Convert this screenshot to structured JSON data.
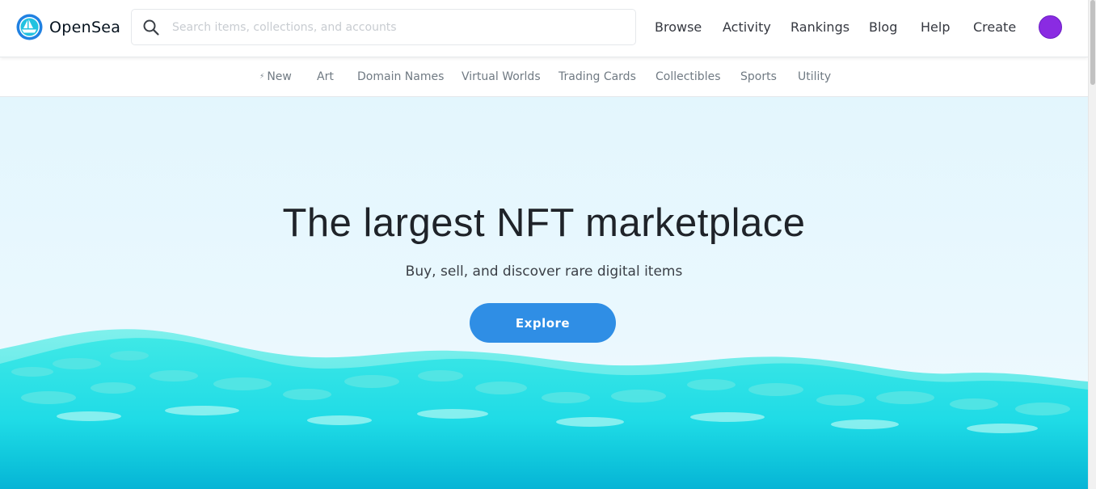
{
  "header": {
    "brand": "OpenSea",
    "logo_icon": "opensea-boat-logo",
    "search": {
      "placeholder": "Search items, collections, and accounts",
      "value": "",
      "icon": "search-icon"
    },
    "nav": [
      "Browse",
      "Activity",
      "Rankings",
      "Blog",
      "Help",
      "Create"
    ],
    "avatar_color": "#8a2be2"
  },
  "categories": {
    "items": [
      "New",
      "Art",
      "Domain Names",
      "Virtual Worlds",
      "Trading Cards",
      "Collectibles",
      "Sports",
      "Utility"
    ],
    "new_icon": "lightning-bolt-icon"
  },
  "hero": {
    "title": "The largest NFT marketplace",
    "subtitle": "Buy, sell, and discover rare digital items",
    "cta": "Explore"
  },
  "colors": {
    "accent": "#2f8ee5",
    "brand": "#2081e2",
    "wave": "#1ad7e0"
  }
}
